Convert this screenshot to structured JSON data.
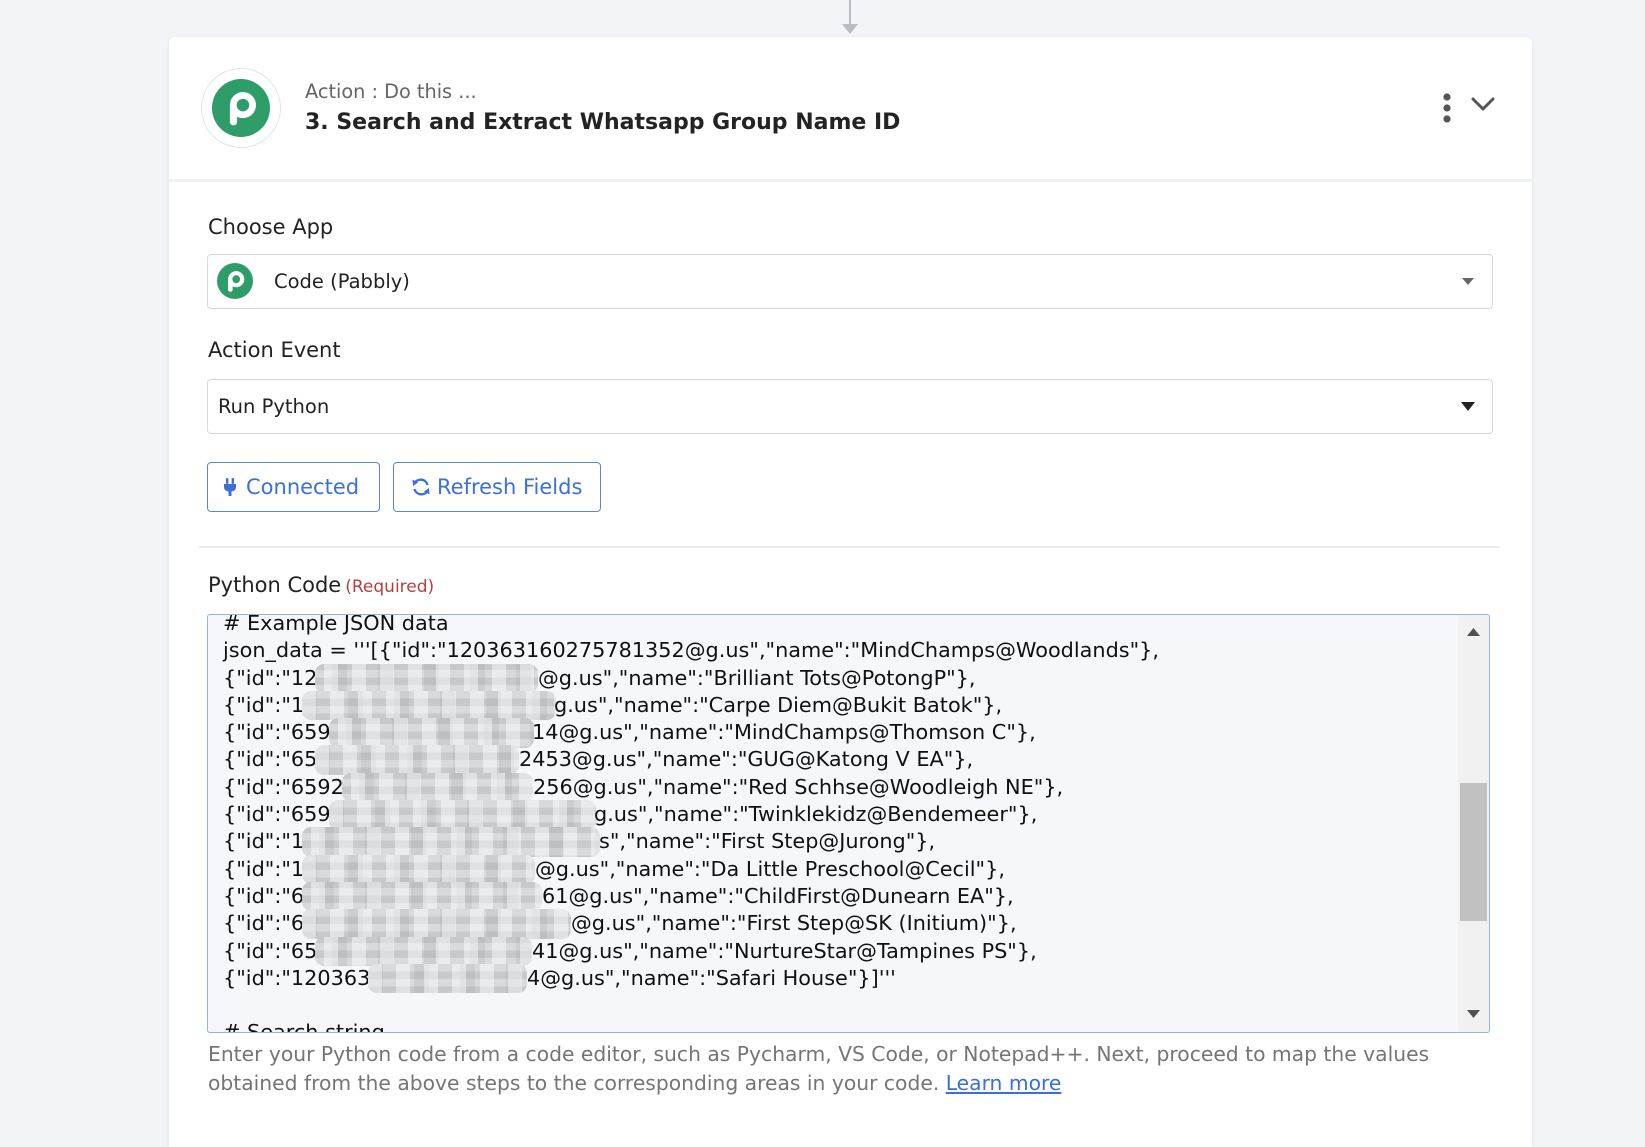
{
  "step": {
    "subtitle": "Action : Do this ...",
    "title": "3. Search and Extract Whatsapp Group Name ID",
    "icon": "pabbly-logo"
  },
  "choose_app": {
    "label": "Choose App",
    "value": "Code (Pabbly)",
    "icon": "pabbly-logo"
  },
  "action_event": {
    "label": "Action Event",
    "value": "Run Python"
  },
  "buttons": {
    "connected": "Connected",
    "connected_icon": "plug-icon",
    "refresh": "Refresh Fields",
    "refresh_icon": "refresh-icon"
  },
  "python_code": {
    "label": "Python Code",
    "required": "(Required)",
    "lines": [
      {
        "text": "# Example JSON data"
      },
      {
        "text": "json_data = '''[{\"id\":\"120363160275781352@g.us\",\"name\":\"MindChamps@Woodlands\"},"
      },
      {
        "prefix": "{\"id\":\"12",
        "suffix": "@g.us\",\"name\":\"Brilliant Tots@PotongP\"},"
      },
      {
        "prefix": "{\"id\":\"1",
        "suffix": "g.us\",\"name\":\"Carpe Diem@Bukit Batok\"},"
      },
      {
        "prefix": "{\"id\":\"659",
        "suffix": "14@g.us\",\"name\":\"MindChamps@Thomson C\"},"
      },
      {
        "prefix": "{\"id\":\"65",
        "suffix": "2453@g.us\",\"name\":\"GUG@Katong V EA\"},"
      },
      {
        "prefix": "{\"id\":\"6592",
        "suffix": "256@g.us\",\"name\":\"Red Schhse@Woodleigh NE\"},"
      },
      {
        "prefix": "{\"id\":\"659",
        "suffix": "g.us\",\"name\":\"Twinklekidz@Bendemeer\"},"
      },
      {
        "prefix": "{\"id\":\"1",
        "suffix": "s\",\"name\":\"First Step@Jurong\"},"
      },
      {
        "prefix": "{\"id\":\"1",
        "suffix": "@g.us\",\"name\":\"Da Little Preschool@Cecil\"},"
      },
      {
        "prefix": "{\"id\":\"6",
        "suffix": "61@g.us\",\"name\":\"ChildFirst@Dunearn EA\"},"
      },
      {
        "prefix": "{\"id\":\"6",
        "suffix": "@g.us\",\"name\":\"First Step@SK (Initium)\"},"
      },
      {
        "prefix": "{\"id\":\"65",
        "suffix": "41@g.us\",\"name\":\"NurtureStar@Tampines PS\"},"
      },
      {
        "prefix": "{\"id\":\"120363",
        "suffix": "4@g.us\",\"name\":\"Safari House\"}]'''"
      },
      {
        "text": ""
      },
      {
        "text": "# Search string"
      }
    ]
  },
  "help": {
    "text": "Enter your Python code from a code editor, such as Pycharm, VS Code, or Notepad++. Next, proceed to map the values obtained from the above steps to the corresponding areas in your code.",
    "link": "Learn more"
  },
  "colors": {
    "brand_green": "#2f9d6a",
    "accent_blue": "#3d6fd6",
    "required_red": "#b5403f"
  }
}
